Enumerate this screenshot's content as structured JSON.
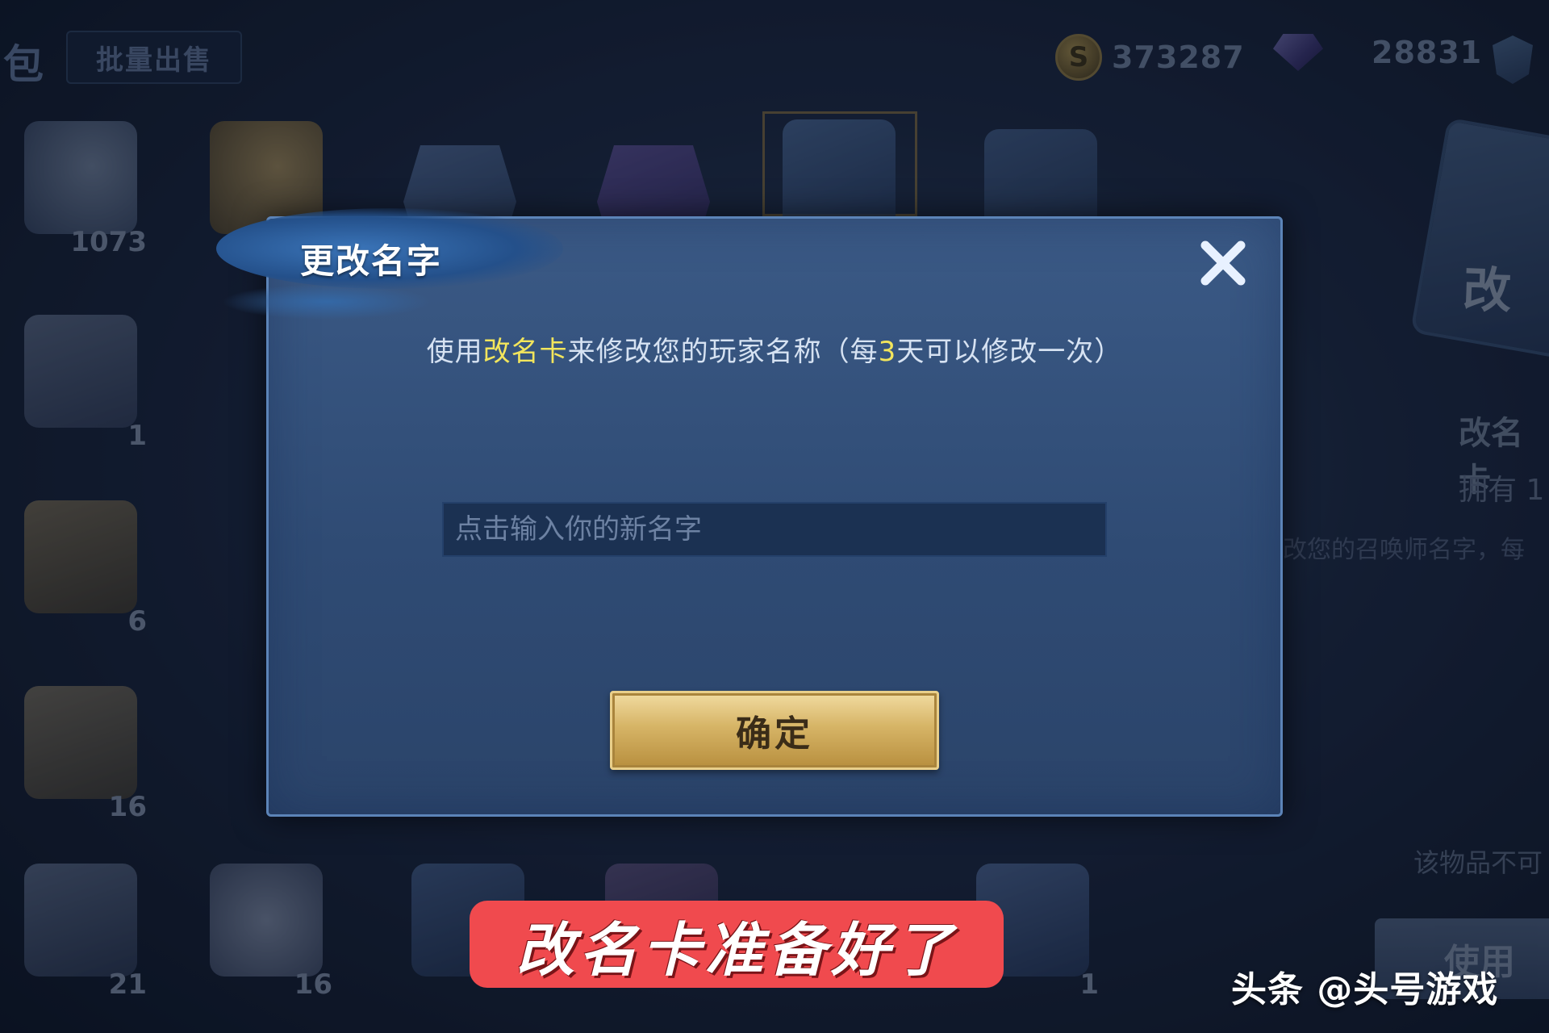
{
  "topbar": {
    "back_char": "包",
    "batch_sell_label": "批量出售",
    "gold_amount": "373287",
    "diamond_amount": "28831"
  },
  "inventory": {
    "item_counts": [
      "1073",
      "1",
      "6",
      "16",
      "21",
      "16",
      "1"
    ],
    "detail": {
      "name": "改名卡",
      "card_glyph": "改",
      "owned": "拥有 1",
      "description": "改您的召唤师名字，每",
      "note": "该物品不可",
      "use_button": "使用"
    }
  },
  "dialog": {
    "title": "更改名字",
    "message_prefix": "使用",
    "message_item": "改名卡",
    "message_mid": "来修改您的玩家名称（每",
    "message_days": "3",
    "message_suffix": "天可以修改一次）",
    "input_placeholder": "点击输入你的新名字",
    "input_value": "",
    "confirm_label": "确定"
  },
  "caption": "改名卡准备好了",
  "watermark": "头条 @头号游戏",
  "colors": {
    "dialog_bg": "#34507a",
    "highlight": "#f2e55c",
    "confirm_gold": "#d6b466",
    "caption_red": "#f04a4e"
  }
}
